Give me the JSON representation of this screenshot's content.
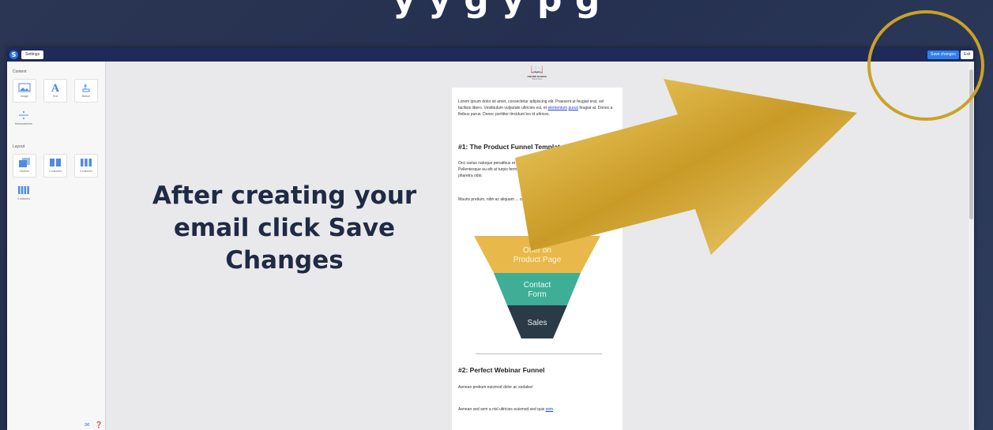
{
  "headline": "y             y          g               y  p g",
  "topbar": {
    "logo": "S",
    "settings_label": "Settings",
    "save_label": "Save changes",
    "exit_label": "Exit"
  },
  "sidebar": {
    "content_title": "Content",
    "content_items": [
      {
        "label": "Image",
        "icon": "image-icon"
      },
      {
        "label": "Text",
        "icon": "text-icon"
      },
      {
        "label": "Button",
        "icon": "button-icon"
      },
      {
        "label": "Horizontal line",
        "icon": "horizontal-line-icon"
      }
    ],
    "layout_title": "Layout",
    "layout_items": [
      {
        "label": "Section",
        "icon": "section-icon"
      },
      {
        "label": "2 columns",
        "icon": "two-columns-icon"
      },
      {
        "label": "3 columns",
        "icon": "three-columns-icon"
      },
      {
        "label": "4 columns",
        "icon": "four-columns-icon"
      }
    ],
    "footer_icons": [
      "chat-icon",
      "help-icon"
    ]
  },
  "document": {
    "logo_name": "ONLINE SCHOOL",
    "logo_sub": "Brand Here",
    "intro_1": "Lorem ipsum dolor sit amet, consectetur adipiscing elit. Praesent ut feugiat erat, vel facilisis libero. Vestibulum vulputate ultricies est, et ",
    "intro_link_1": "elementum",
    "intro_link_2": "purus",
    "intro_2": " feugiat at. Donec a finibus purus. Donec porttitor tincidunt leo id ultrices.",
    "heading_1": "#1: The Product Funnel Template",
    "para_2a": "Orci varius natoque penatibus et magnis dis parturient montes, nascetur ridiculus mus. Pellentesque eu elit at turpis fermentum",
    "para_2_link": "Vestibulum tincidunt a leo",
    "para_2b": " sit amet ... ligula non, pharetra odio.",
    "para_3": "Mauris pretium, nibh ac aliquam ... convallis enim purus non arcu.",
    "funnel": [
      {
        "label": "Offer on\nProduct Page",
        "color": "#e8b94a"
      },
      {
        "label": "Contact\nForm",
        "color": "#3fae96"
      },
      {
        "label": "Sales",
        "color": "#2b3a47"
      }
    ],
    "heading_2": "#2: Perfect Webinar Funnel",
    "para_4": "Aenean pretium euismod dolor ac sodales!",
    "para_5a": "Aenean sed sem a nisl ultricies euismod sed quis ",
    "para_5_link": "sem",
    "para_5b": "."
  },
  "overlay": {
    "text": "After creating your email click Save Changes",
    "arrow_color": "#d4a52a",
    "circle_color": "#c9a227"
  }
}
